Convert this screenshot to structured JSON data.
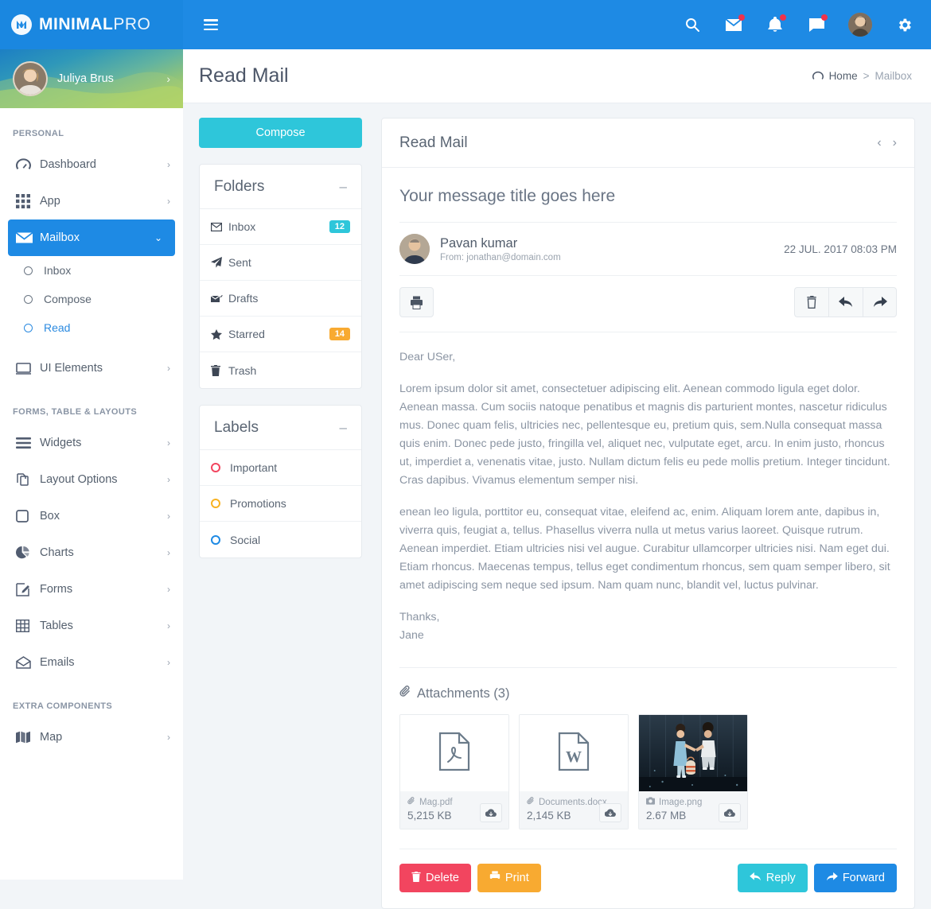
{
  "brand": {
    "bold": "MINIMAL",
    "light": "PRO"
  },
  "topnav": {
    "icons": [
      {
        "name": "search-icon",
        "dot": false
      },
      {
        "name": "mail-icon",
        "dot": true
      },
      {
        "name": "bell-icon",
        "dot": true
      },
      {
        "name": "chat-icon",
        "dot": true
      }
    ],
    "avatar_name": "user-avatar",
    "settings_name": "gear-icon"
  },
  "sidebar": {
    "profile_name": "Juliya Brus",
    "sections": [
      {
        "title": "PERSONAL",
        "items": [
          {
            "label": "Dashboard",
            "icon": "dashboard-icon",
            "arrow": "›",
            "active": false
          },
          {
            "label": "App",
            "icon": "grid-icon",
            "arrow": "›",
            "active": false
          },
          {
            "label": "Mailbox",
            "icon": "envelope-icon",
            "arrow": "⌄",
            "active": true
          }
        ],
        "subitems": [
          {
            "label": "Inbox",
            "selected": false
          },
          {
            "label": "Compose",
            "selected": false
          },
          {
            "label": "Read",
            "selected": true
          }
        ],
        "after": [
          {
            "label": "UI Elements",
            "icon": "monitor-icon",
            "arrow": "›",
            "active": false
          }
        ]
      },
      {
        "title": "FORMS, TABLE & LAYOUTS",
        "items": [
          {
            "label": "Widgets",
            "icon": "bars-icon",
            "arrow": "›",
            "active": false
          },
          {
            "label": "Layout Options",
            "icon": "copy-icon",
            "arrow": "›",
            "active": false
          },
          {
            "label": "Box",
            "icon": "square-icon",
            "arrow": "›",
            "active": false
          },
          {
            "label": "Charts",
            "icon": "pie-chart-icon",
            "arrow": "›",
            "active": false
          },
          {
            "label": "Forms",
            "icon": "edit-icon",
            "arrow": "›",
            "active": false
          },
          {
            "label": "Tables",
            "icon": "table-icon",
            "arrow": "›",
            "active": false
          },
          {
            "label": "Emails",
            "icon": "open-envelope-icon",
            "arrow": "›",
            "active": false
          }
        ]
      },
      {
        "title": "EXTRA COMPONENTS",
        "items": [
          {
            "label": "Map",
            "icon": "map-icon",
            "arrow": "›",
            "active": false
          }
        ]
      }
    ]
  },
  "page": {
    "title": "Read Mail",
    "breadcrumb": {
      "home": "Home",
      "sep": ">",
      "current": "Mailbox"
    }
  },
  "mailnav": {
    "compose_label": "Compose",
    "folders": {
      "title": "Folders",
      "collapse": "–",
      "items": [
        {
          "label": "Inbox",
          "icon": "envelope-icon",
          "badge": "12",
          "badge_color": "cyan"
        },
        {
          "label": "Sent",
          "icon": "paper-plane-icon",
          "badge": "",
          "badge_color": ""
        },
        {
          "label": "Drafts",
          "icon": "drafts-icon",
          "badge": "",
          "badge_color": ""
        },
        {
          "label": "Starred",
          "icon": "star-icon",
          "badge": "14",
          "badge_color": "orange"
        },
        {
          "label": "Trash",
          "icon": "trash-icon",
          "badge": "",
          "badge_color": ""
        }
      ]
    },
    "labels": {
      "title": "Labels",
      "collapse": "–",
      "items": [
        {
          "label": "Important",
          "color": "#f2455f"
        },
        {
          "label": "Promotions",
          "color": "#f8b221"
        },
        {
          "label": "Social",
          "color": "#1e8ae4"
        }
      ]
    }
  },
  "mail": {
    "card_title": "Read Mail",
    "prev": "‹",
    "next": "›",
    "subject": "Your message title goes here",
    "sender_name": "Pavan kumar",
    "sender_from": "From: jonathan@domain.com",
    "date": "22 JUL. 2017 08:03 PM",
    "toolbar": {
      "print": "print-icon",
      "delete": "trash-icon",
      "reply": "reply-icon",
      "forward": "forward-icon"
    },
    "body": [
      "Dear USer,",
      "Lorem ipsum dolor sit amet, consectetuer adipiscing elit. Aenean commodo ligula eget dolor. Aenean massa. Cum sociis natoque penatibus et magnis dis parturient montes, nascetur ridiculus mus. Donec quam felis, ultricies nec, pellentesque eu, pretium quis, sem.Nulla consequat massa quis enim. Donec pede justo, fringilla vel, aliquet nec, vulputate eget, arcu. In enim justo, rhoncus ut, imperdiet a, venenatis vitae, justo. Nullam dictum felis eu pede mollis pretium. Integer tincidunt. Cras dapibus. Vivamus elementum semper nisi.",
      "enean leo ligula, porttitor eu, consequat vitae, eleifend ac, enim. Aliquam lorem ante, dapibus in, viverra quis, feugiat a, tellus. Phasellus viverra nulla ut metus varius laoreet. Quisque rutrum. Aenean imperdiet. Etiam ultricies nisi vel augue. Curabitur ullamcorper ultricies nisi. Nam eget dui. Etiam rhoncus. Maecenas tempus, tellus eget condimentum rhoncus, sem quam semper libero, sit amet adipiscing sem neque sed ipsum. Nam quam nunc, blandit vel, luctus pulvinar.",
      "Thanks,"
    ],
    "signature": "Jane",
    "attachments_title": "Attachments (3)",
    "attachments": [
      {
        "name": "Mag.pdf",
        "size": "5,215 KB",
        "kind": "pdf",
        "name_icon": "paperclip-icon"
      },
      {
        "name": "Documents.docx",
        "size": "2,145 KB",
        "kind": "word",
        "name_icon": "paperclip-icon"
      },
      {
        "name": "Image.png",
        "size": "2.67 MB",
        "kind": "image",
        "name_icon": "camera-icon"
      }
    ],
    "buttons": {
      "delete": "Delete",
      "print": "Print",
      "reply": "Reply",
      "forward": "Forward"
    }
  },
  "colors": {
    "header_blue": "#1e8ae4",
    "accent_cyan": "#2ec6da",
    "warning_orange": "#f8aa31",
    "danger_red": "#f2455f"
  }
}
